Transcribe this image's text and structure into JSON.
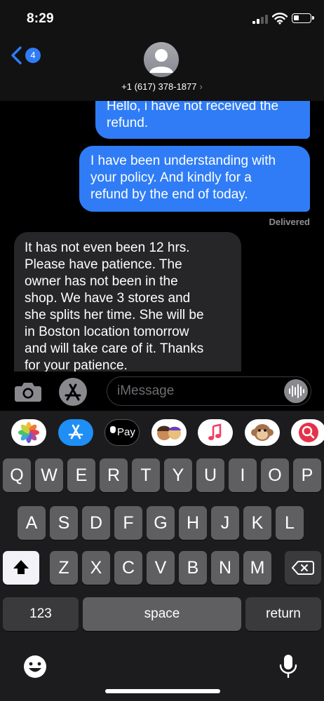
{
  "status_bar": {
    "time": "8:29"
  },
  "header": {
    "back_badge_count": "4",
    "contact_name": "+1 (617) 378-1877",
    "contact_chevron": "›"
  },
  "messages": [
    {
      "direction": "outgoing",
      "text": "Hello, i have not received the\nrefund."
    },
    {
      "direction": "outgoing",
      "text": "I have been understanding with\nyour policy. And kindly for a\nrefund by the end of today."
    },
    {
      "direction": "incoming",
      "text": "It has not even been 12 hrs.\nPlease have patience.  The\nowner has not been in the\nshop.  We have 3 stores and\nshe splits her time.  She will be\nin Boston location tomorrow\nand will take care of it.  Thanks\nfor your patience."
    }
  ],
  "delivered_label": "Delivered",
  "input": {
    "placeholder": "iMessage",
    "value": ""
  },
  "app_drawer": {
    "apps": [
      {
        "name": "photos-app-icon"
      },
      {
        "name": "app-store-app-icon"
      },
      {
        "name": "apple-pay-app-icon",
        "label": "Pay"
      },
      {
        "name": "memoji-stickers-app-icon"
      },
      {
        "name": "music-app-icon"
      },
      {
        "name": "animoji-app-icon"
      },
      {
        "name": "image-search-app-icon"
      }
    ]
  },
  "keyboard": {
    "row1": [
      "Q",
      "W",
      "E",
      "R",
      "T",
      "Y",
      "U",
      "I",
      "O",
      "P"
    ],
    "row2": [
      "A",
      "S",
      "D",
      "F",
      "G",
      "H",
      "J",
      "K",
      "L"
    ],
    "row3": [
      "Z",
      "X",
      "C",
      "V",
      "B",
      "N",
      "M"
    ],
    "numbers_label": "123",
    "space_label": "space",
    "return_label": "return"
  }
}
